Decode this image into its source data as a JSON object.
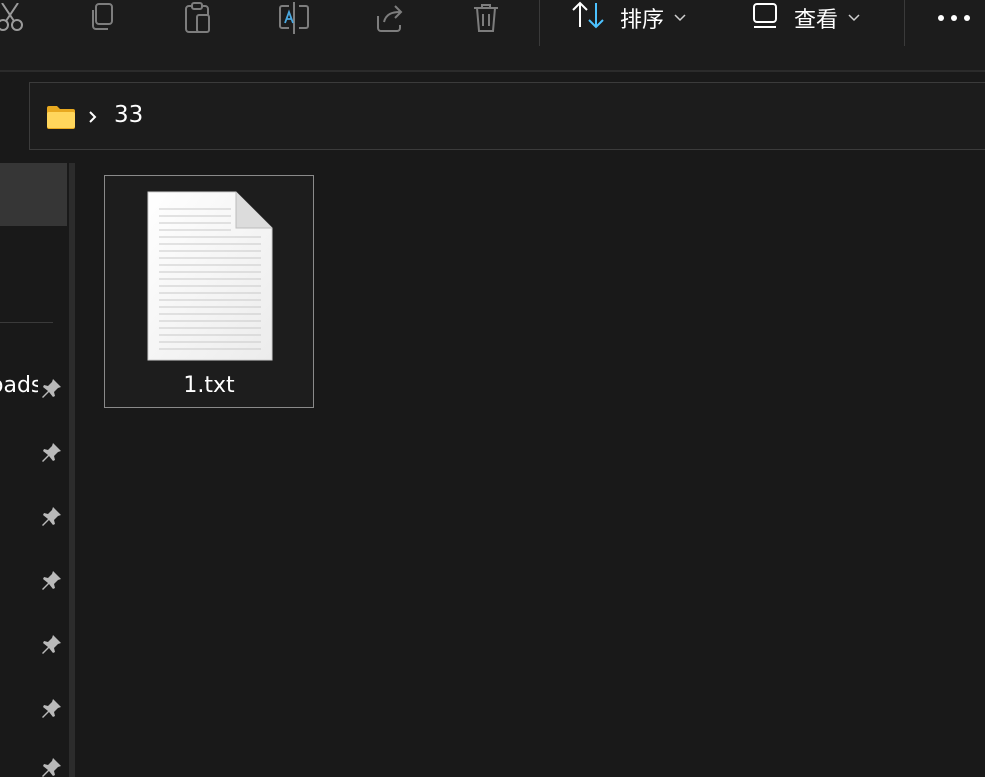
{
  "toolbar": {
    "icons": [
      "scissors-icon",
      "copy-icon",
      "paste-icon",
      "rename-icon",
      "share-icon",
      "delete-icon"
    ],
    "sort": {
      "icon": "sort-arrows-icon",
      "label": "排序"
    },
    "view": {
      "icon": "view-icon",
      "label": "查看"
    },
    "more": "more-icon",
    "accent": "#4cc2ff"
  },
  "address": {
    "icon": "folder-icon",
    "separator": "chevron-right-icon",
    "path": "33"
  },
  "nav": {
    "clipped_label": "oads",
    "pin_icon": "pin-icon"
  },
  "files": [
    {
      "name": "1.txt",
      "icon": "text-document-icon"
    }
  ]
}
